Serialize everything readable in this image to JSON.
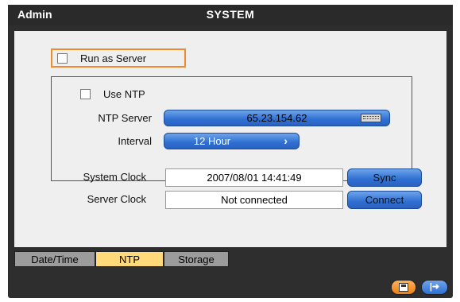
{
  "title_bar": {
    "user": "Admin",
    "title": "SYSTEM"
  },
  "run_as_server": {
    "label": "Run as Server",
    "checked": false
  },
  "ntp": {
    "use_ntp_label": "Use NTP",
    "use_ntp_checked": false,
    "server_label": "NTP Server",
    "server_value": "65.23.154.62",
    "interval_label": "Interval",
    "interval_value": "12 Hour"
  },
  "clocks": {
    "system_label": "System Clock",
    "system_value": "2007/08/01 14:41:49",
    "sync_label": "Sync",
    "server_label": "Server Clock",
    "server_value": "Not connected",
    "connect_label": "Connect"
  },
  "tabs": [
    {
      "label": "Date/Time",
      "active": false
    },
    {
      "label": "NTP",
      "active": true
    },
    {
      "label": "Storage",
      "active": false
    }
  ],
  "bottom_buttons": {
    "save_icon": "save-icon",
    "exit_icon": "exit-icon"
  },
  "colors": {
    "accent_orange": "#f08a2e",
    "active_tab": "#ffd97a",
    "button_blue": "#2f6fd2",
    "background": "#2e2e2e"
  }
}
